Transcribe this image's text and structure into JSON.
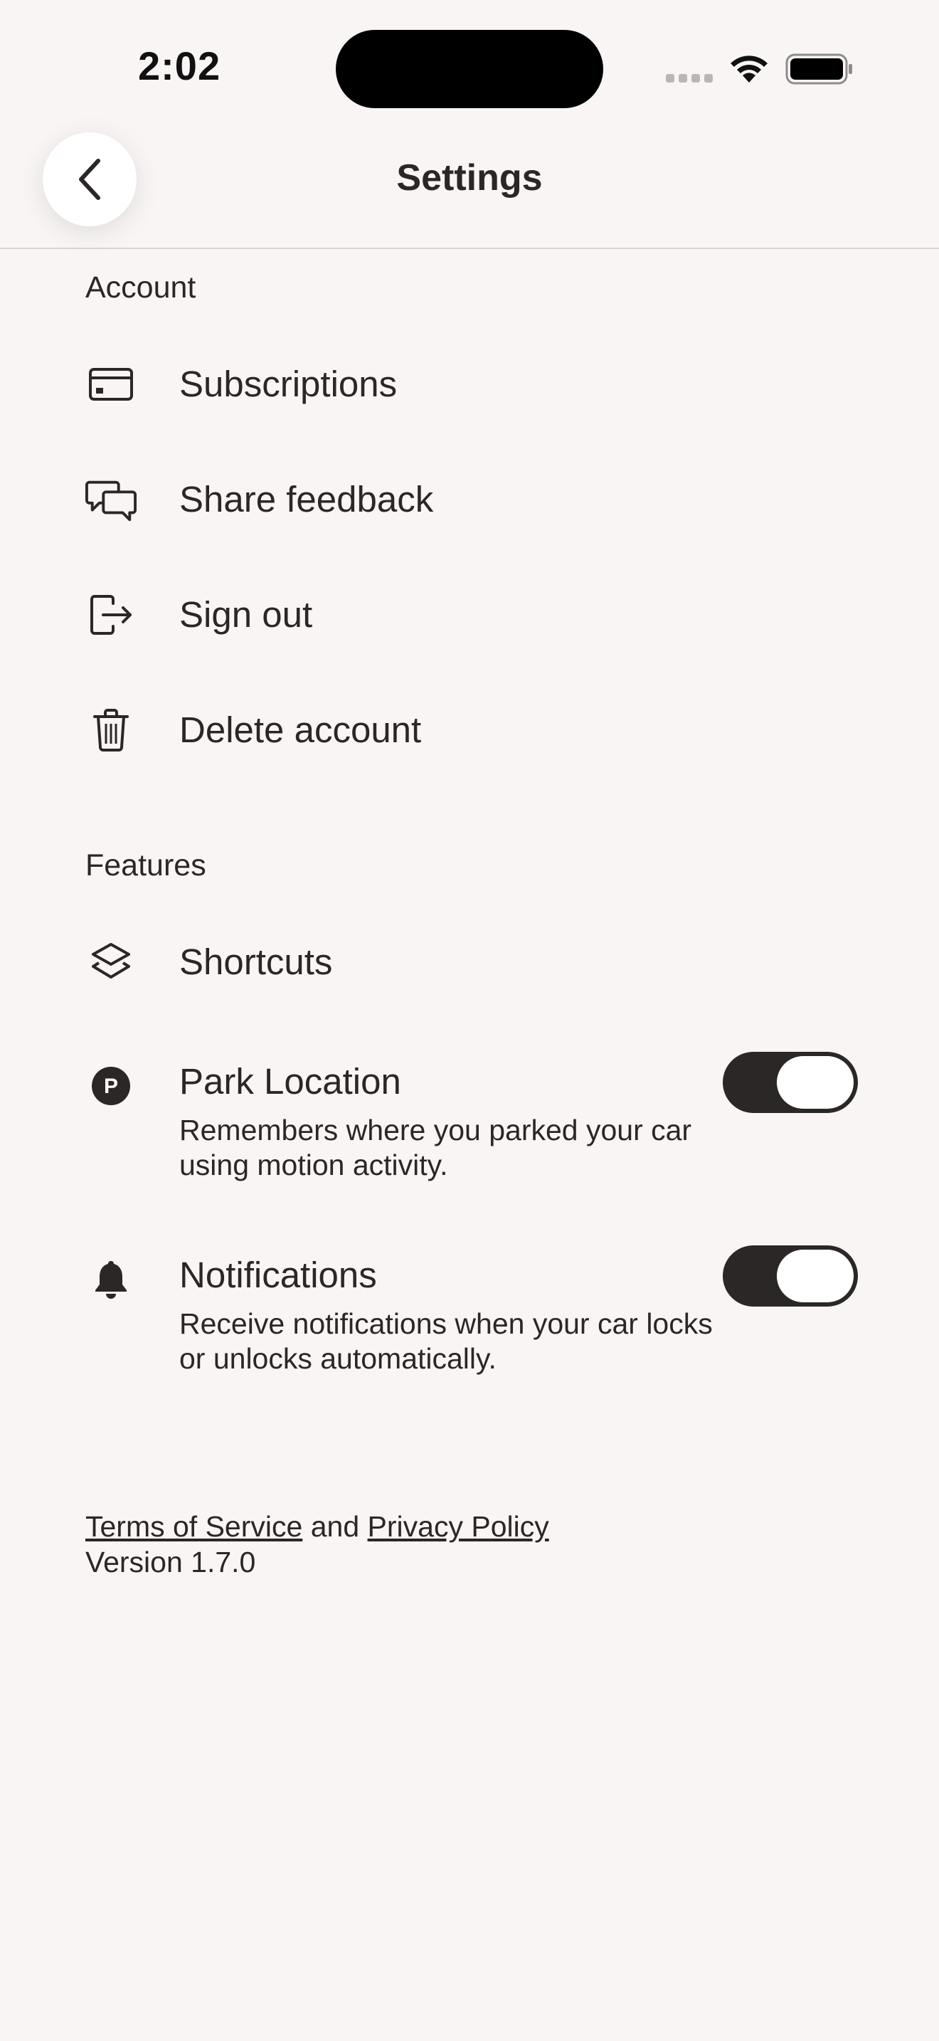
{
  "status_bar": {
    "time": "2:02"
  },
  "header": {
    "title": "Settings"
  },
  "account": {
    "label": "Account",
    "items": [
      {
        "label": "Subscriptions",
        "icon": "credit-card-icon"
      },
      {
        "label": "Share feedback",
        "icon": "chat-bubbles-icon"
      },
      {
        "label": "Sign out",
        "icon": "sign-out-icon"
      },
      {
        "label": "Delete account",
        "icon": "trash-icon"
      }
    ]
  },
  "features": {
    "label": "Features",
    "shortcuts": {
      "label": "Shortcuts",
      "icon": "layers-icon"
    },
    "park_location": {
      "label": "Park Location",
      "description": "Remembers where you parked your car using motion activity.",
      "icon": "parking-icon",
      "enabled": true
    },
    "notifications": {
      "label": "Notifications",
      "description": "Receive notifications when your car locks or unlocks automatically.",
      "icon": "bell-icon",
      "enabled": true
    }
  },
  "footer": {
    "terms": "Terms of Service",
    "and": "and",
    "privacy": "Privacy Policy",
    "version": "Version 1.7.0"
  },
  "colors": {
    "background": "#f8f5f4",
    "text": "#2b2726",
    "toggle_on": "#2b2726"
  }
}
